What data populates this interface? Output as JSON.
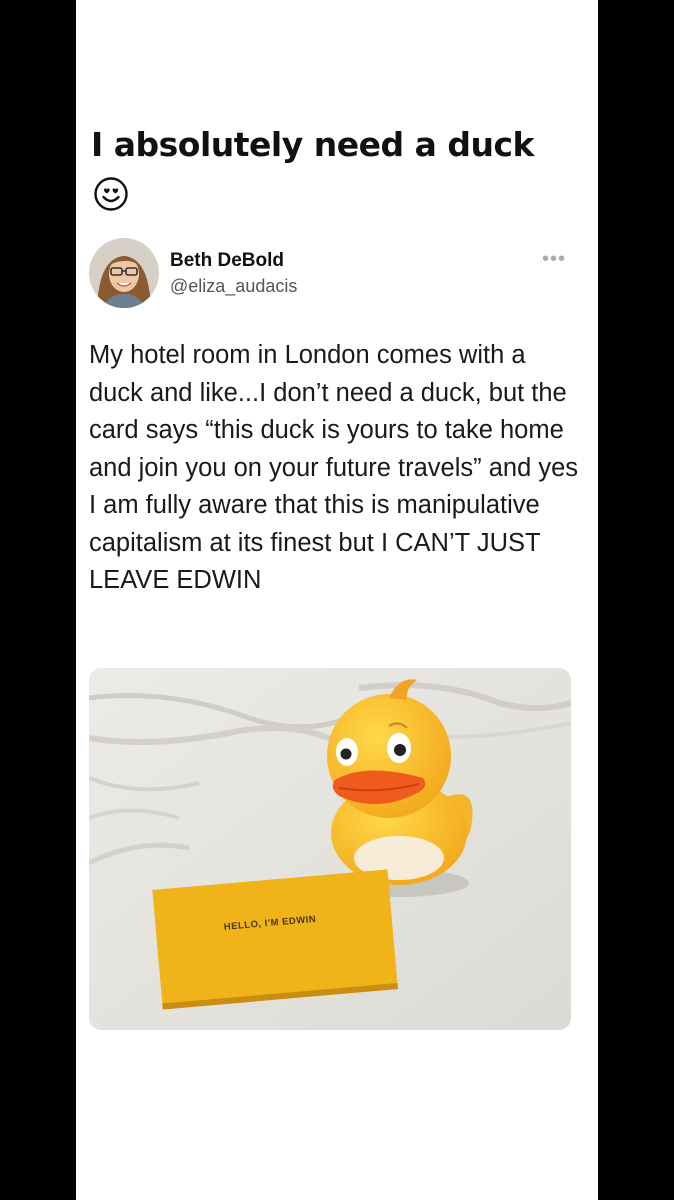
{
  "post": {
    "heading": "I absolutely need a duck",
    "heading_emoji": "smiling-face-with-heart-eyes-icon"
  },
  "tweet": {
    "display_name": "Beth DeBold",
    "handle": "@eliza_audacis",
    "more_icon": "more-options-icon",
    "text": "My hotel room in London comes with a duck and like...I don’t need a duck, but the card says “this duck is yours to take home and join you on your future travels” and yes I am fully aware that this is manipulative capitalism at its finest but I CAN’T JUST LEAVE EDWIN",
    "photo": {
      "card_text": "HELLO, I'M EDWIN"
    }
  },
  "colors": {
    "background": "#000000",
    "card": "#ffffff",
    "text": "#111111",
    "handle": "#555555",
    "duck": "#f8c21f",
    "beak": "#ee5b1c",
    "card_yellow": "#f0b319"
  }
}
